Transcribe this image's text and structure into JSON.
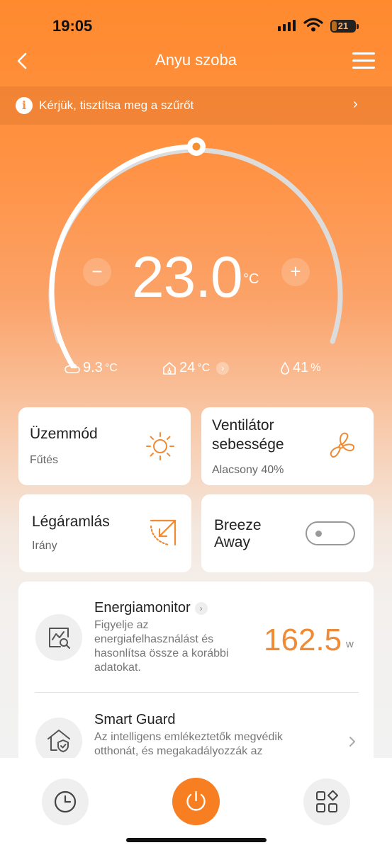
{
  "status_bar": {
    "time": "19:05",
    "battery": "21",
    "battery_level": 0.21
  },
  "header": {
    "title": "Anyu szoba"
  },
  "banner": {
    "text": "Kérjük, tisztítsa meg a szűrőt"
  },
  "thermostat": {
    "setpoint": "23.0",
    "unit": "°C",
    "minus_label": "−",
    "plus_label": "+",
    "level": 0.5
  },
  "stats": {
    "outdoor": {
      "value": "9.3",
      "unit": "°C"
    },
    "indoor": {
      "value": "24",
      "unit": "°C"
    },
    "humidity": {
      "value": "41",
      "unit": "%"
    }
  },
  "cards": {
    "mode": {
      "title": "Üzemmód",
      "subtitle": "Fűtés"
    },
    "fan": {
      "title_line1": "Ventilátor",
      "title_line2": "sebessége",
      "subtitle": "Alacsony 40%"
    },
    "airflow": {
      "title": "Légáramlás",
      "subtitle": "Irány"
    },
    "breeze": {
      "title_line1": "Breeze",
      "title_line2": "Away",
      "enabled": false
    }
  },
  "energy": {
    "title": "Energiamonitor",
    "desc_lines": [
      "Figyelje az",
      "energiafelhasználást és",
      "hasonlítsa össze a korábbi",
      "adatokat."
    ],
    "value": "162.5",
    "unit": "w"
  },
  "smart_guard": {
    "title": "Smart Guard",
    "desc_lines": [
      "Az intelligens emlékeztetők megvédik",
      "otthonát, és megakadályozzák az"
    ]
  },
  "colors": {
    "accent": "#f77f21",
    "accent_text": "#f08a34"
  },
  "icons": {
    "mode": "sun-icon",
    "fan": "fan-icon",
    "airflow": "airflow-direction-icon",
    "energy": "energy-monitor-icon",
    "guard": "shield-home-icon",
    "schedule": "clock-icon",
    "power": "power-icon",
    "apps": "apps-grid-icon"
  }
}
